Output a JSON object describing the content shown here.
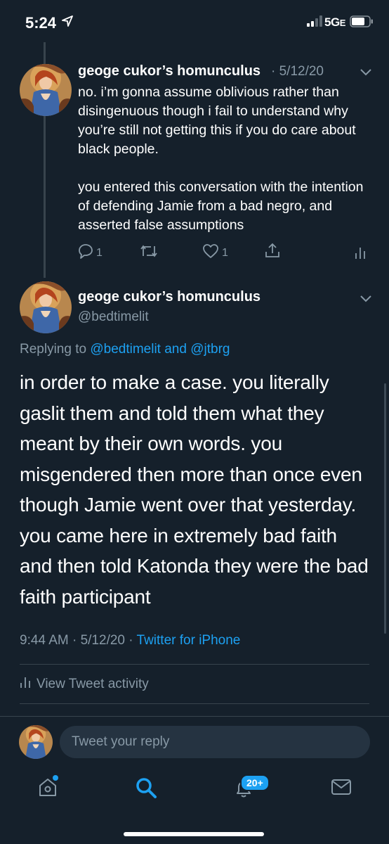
{
  "status_bar": {
    "time": "5:24",
    "network": "5G",
    "network_suffix": "E"
  },
  "tweet_prev": {
    "author_name": "geoge cukor’s homunculus",
    "date": "· 5/12/20",
    "paragraph1": "no. i’m gonna assume oblivious rather than disingenuous though i fail to understand why you’re still not getting this if you do care about black people.",
    "paragraph2": "you entered this conversation with the intention of defending Jamie from a bad negro, and asserted false assumptions",
    "reply_count": "1",
    "like_count": "1",
    "icons": [
      "reply-icon",
      "retweet-icon",
      "like-icon",
      "share-icon",
      "analytics-icon"
    ]
  },
  "tweet_main": {
    "author_name": "geoge cukor’s homunculus",
    "handle": "@bedtimelit",
    "replying_prefix": "Replying to ",
    "replying_mention1": "@bedtimelit",
    "replying_and": " and ",
    "replying_mention2": "@jtbrg",
    "text": "in order to make a case. you literally gaslit them and told them what they meant by their own words. you misgendered then more than once even though Jamie went over that yesterday. you came here in extremely bad faith and then told Katonda they were the bad faith participant",
    "time": "9:44 AM · 5/12/20 · ",
    "source": "Twitter for iPhone",
    "activity_label": "View Tweet activity"
  },
  "reply_bar": {
    "placeholder": "Tweet your reply"
  },
  "tabbar": {
    "notifications_badge": "20+",
    "tabs": [
      "home-icon",
      "search-icon",
      "notifications-icon",
      "messages-icon"
    ]
  },
  "colors": {
    "background": "#15202b",
    "accent": "#1da1f2",
    "secondary_text": "#8899a6",
    "divider": "#38444d"
  }
}
